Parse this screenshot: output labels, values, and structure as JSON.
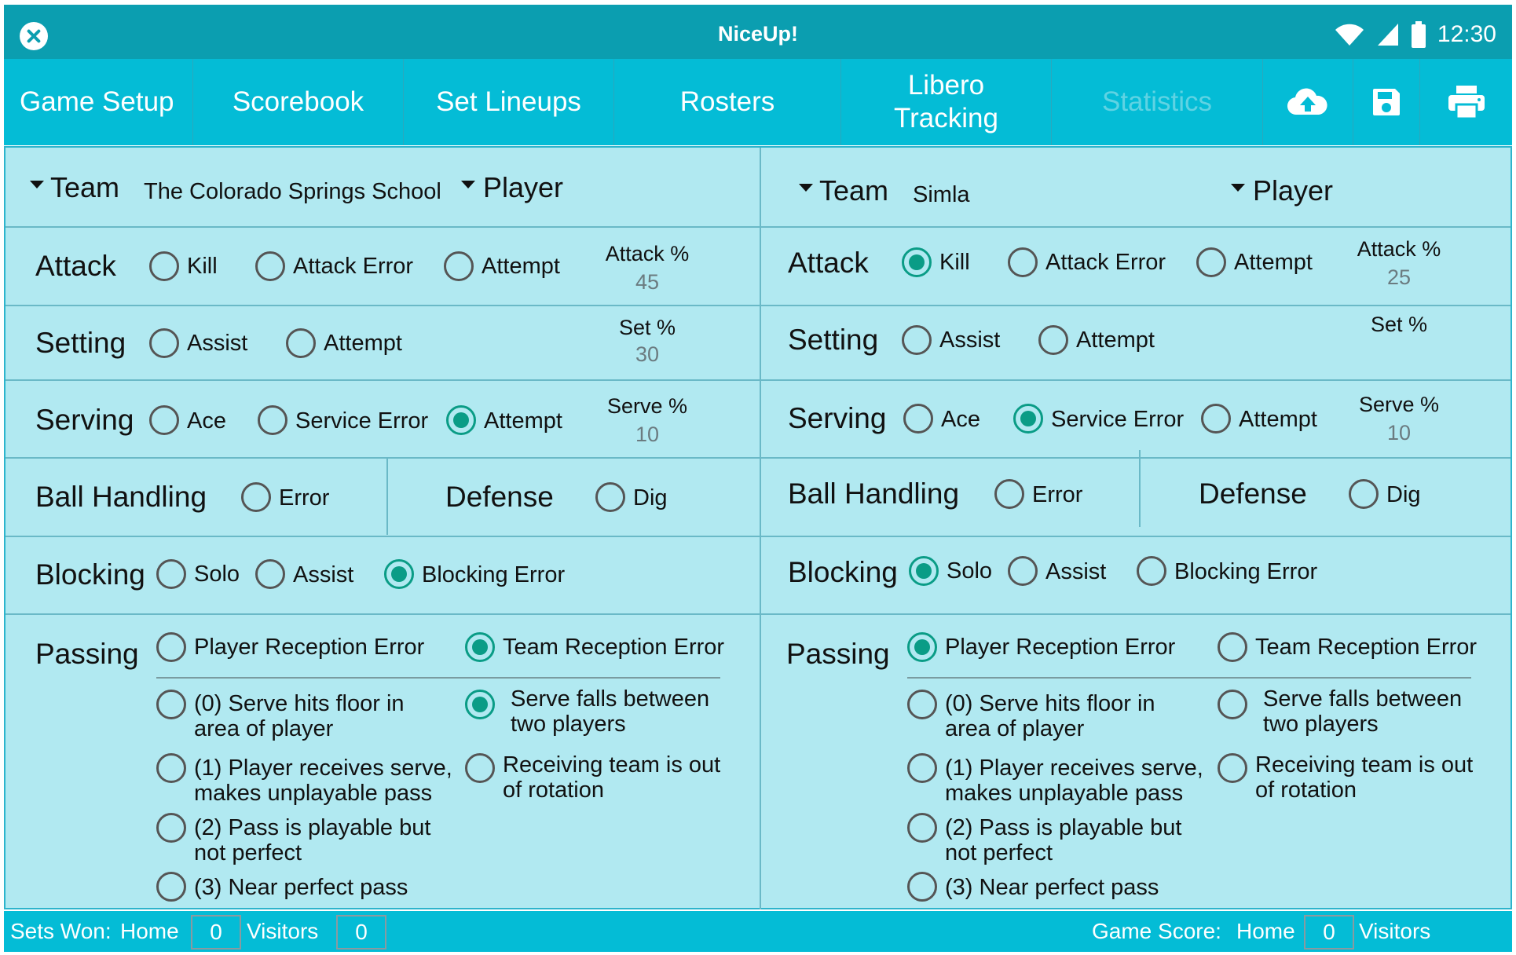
{
  "status_bar": {
    "title": "NiceUp!",
    "time": "12:30"
  },
  "nav": {
    "tabs": [
      {
        "label": "Game Setup"
      },
      {
        "label": "Scorebook"
      },
      {
        "label": "Set Lineups"
      },
      {
        "label": "Rosters"
      },
      {
        "label": "Libero Tracking"
      },
      {
        "label": "Statistics"
      }
    ],
    "icons": [
      "cloud-upload-icon",
      "save-icon",
      "print-icon"
    ]
  },
  "labels": {
    "team": "Team",
    "player": "Player",
    "attack": "Attack",
    "setting": "Setting",
    "serving": "Serving",
    "ball_handling": "Ball Handling",
    "defense": "Defense",
    "blocking": "Blocking",
    "passing": "Passing",
    "kill": "Kill",
    "attack_error": "Attack Error",
    "attempt": "Attempt",
    "assist": "Assist",
    "ace": "Ace",
    "service_error": "Service Error",
    "error": "Error",
    "dig": "Dig",
    "solo": "Solo",
    "blocking_error": "Blocking Error",
    "player_reception_error": "Player Reception Error",
    "team_reception_error": "Team Reception Error",
    "pass0": "(0) Serve hits floor in\narea of player",
    "pass1": "(1) Player receives serve,\nmakes unplayable pass",
    "pass2": "(2) Pass is playable but\nnot perfect",
    "pass3": "(3) Near perfect pass",
    "serve_between": "Serve falls between\ntwo players",
    "out_of_rotation": "Receiving team is out\nof rotation",
    "attack_pct": "Attack %",
    "set_pct": "Set %",
    "serve_pct": "Serve %"
  },
  "home": {
    "team_name": "The Colorado Springs School",
    "attack_pct": "45",
    "set_pct": "30",
    "serve_pct": "10",
    "selected": [
      "serving-attempt",
      "blocking-error",
      "team-reception-error",
      "serve-between"
    ]
  },
  "visitor": {
    "team_name": "Simla",
    "attack_pct": "25",
    "set_pct": "",
    "serve_pct": "10",
    "selected": [
      "attack-kill",
      "service-error",
      "blocking-solo",
      "player-reception-error"
    ]
  },
  "footer": {
    "sets_won_label": "Sets Won:",
    "home_label": "Home",
    "visitors_label": "Visitors",
    "home_sets": "0",
    "visitor_sets": "0",
    "game_score_label": "Game Score:",
    "home_score": "0"
  },
  "colors": {
    "teal": "#04bcd6",
    "panel": "#b1e9f1",
    "radio_on": "#0a9c86"
  }
}
